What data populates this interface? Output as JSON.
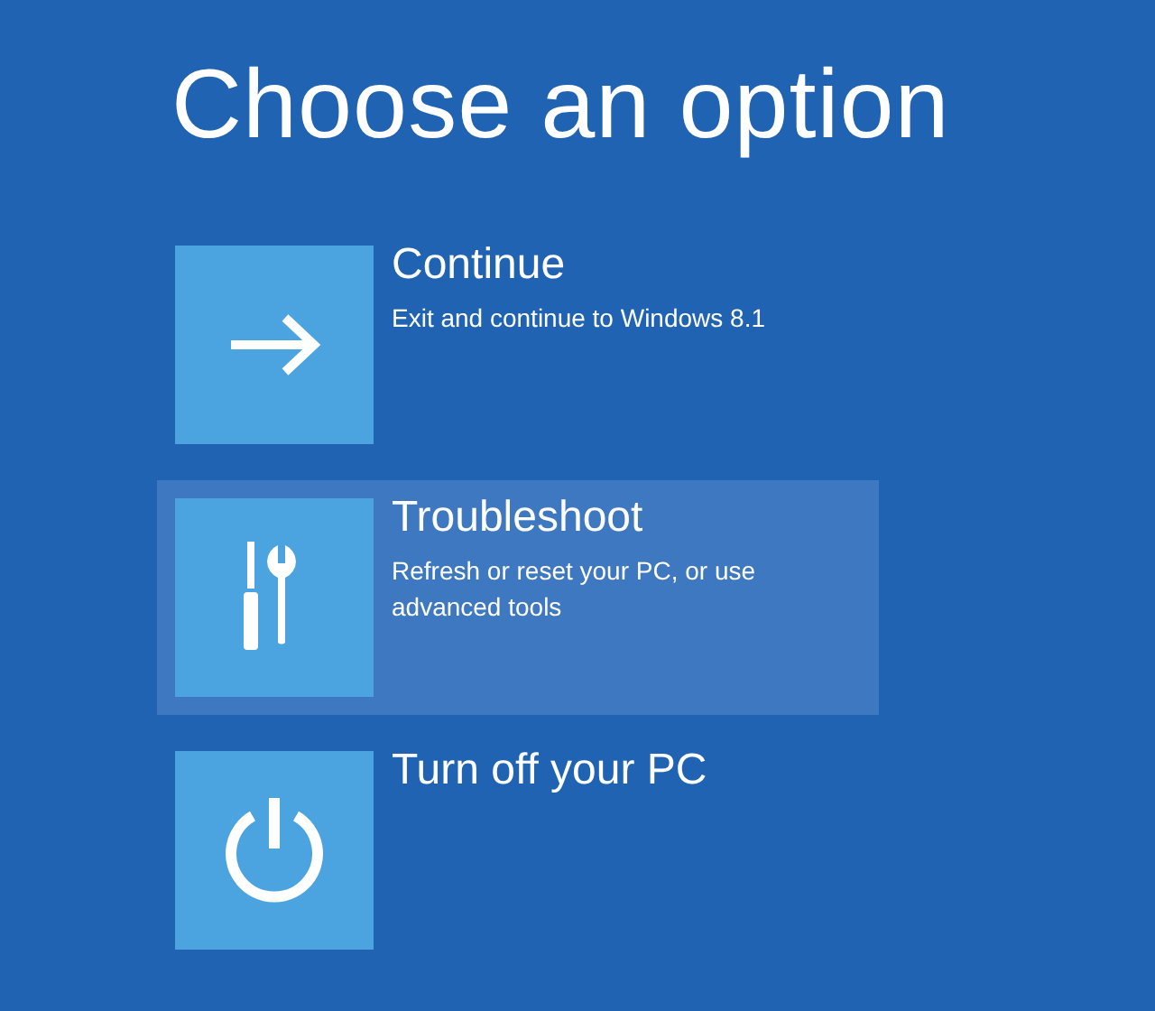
{
  "title": "Choose an option",
  "options": [
    {
      "title": "Continue",
      "description": "Exit and continue to Windows 8.1",
      "selected": false
    },
    {
      "title": "Troubleshoot",
      "description": "Refresh or reset your PC, or use advanced tools",
      "selected": true
    },
    {
      "title": "Turn off your PC",
      "selected": false
    }
  ]
}
